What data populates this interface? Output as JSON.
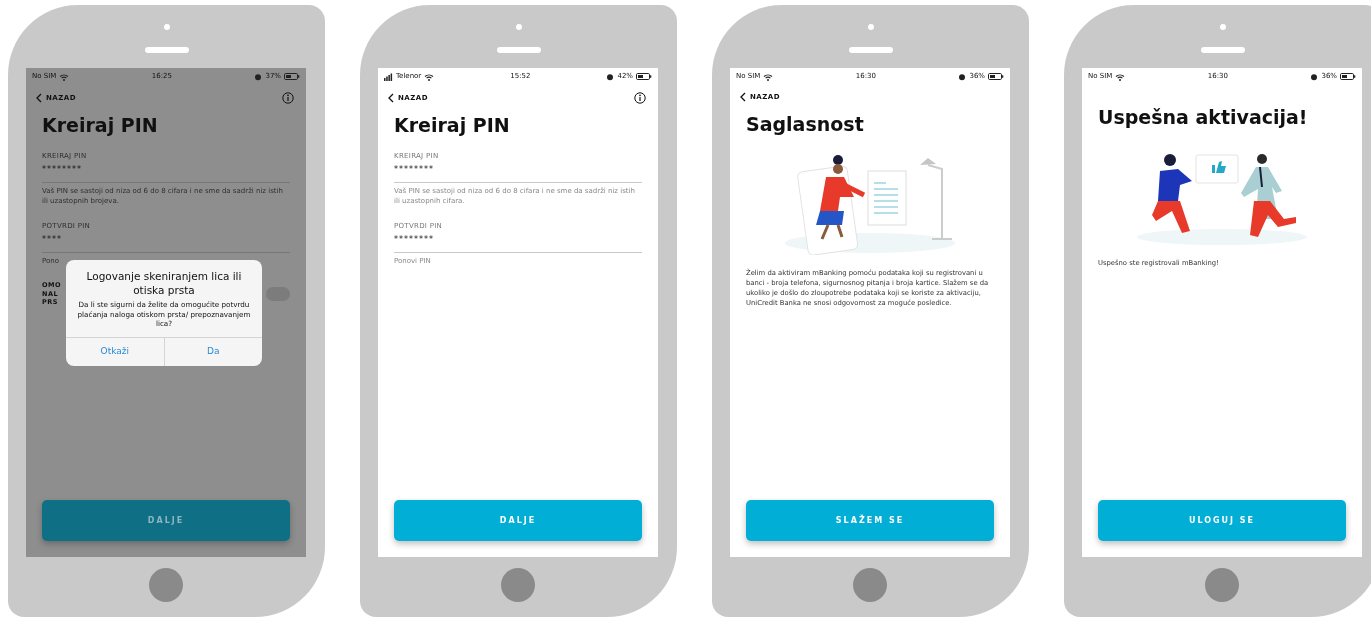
{
  "phones": [
    {
      "kind": "pin",
      "dimmed": true,
      "status": {
        "carrier": "No SIM",
        "signal": false,
        "time": "16:25",
        "battery": "37%"
      },
      "back": "NAZAD",
      "info": true,
      "title": "Kreiraj PIN",
      "fields": [
        {
          "label": "KREIRAJ PIN",
          "value": "********",
          "hint": "Vaš PIN se sastoji od niza od 6 do 8 cifara i ne sme da sadrži niz istih ili uzastopnih brojeva."
        },
        {
          "label": "POTVRDI PIN",
          "value": "****",
          "hint": "Pono"
        }
      ],
      "toggle": {
        "label_lines": [
          "OMO",
          "NAL",
          "PRS"
        ],
        "on": false
      },
      "dialog": {
        "title": "Logovanje skeniranjem lica ili otiska prsta",
        "message": "Da li ste sigurni da želite da omogućite potvrdu plaćanja naloga otiskom prsta/ prepoznavanjem lica?",
        "buttons": [
          "Otkaži",
          "Da"
        ]
      },
      "button": "DALJE"
    },
    {
      "kind": "pin",
      "dimmed": false,
      "status": {
        "carrier": "Telenor",
        "signal": true,
        "time": "15:52",
        "battery": "42%"
      },
      "back": "NAZAD",
      "info": true,
      "title": "Kreiraj PIN",
      "fields": [
        {
          "label": "KREIRAJ PIN",
          "value": "********",
          "hint": "Vaš PIN se sastoji od niza od 6 do 8 cifara i ne sme da sadrži niz istih ili uzastopnih cifara."
        },
        {
          "label": "POTVRDI PIN",
          "value": "********",
          "hint": "Ponovi PIN"
        }
      ],
      "button": "DALJE"
    },
    {
      "kind": "consent",
      "dimmed": false,
      "status": {
        "carrier": "No SIM",
        "signal": false,
        "time": "16:30",
        "battery": "36%"
      },
      "back": "NAZAD",
      "info": false,
      "title": "Saglasnost",
      "text": "Želim da aktiviram mBanking pomoću podataka koji su registrovani u banci - broja telefona, sigurnosnog pitanja i broja kartice. Slažem se da ukoliko je došlo do zloupotrebe podataka koji se koriste za aktivaciju, UniCredit Banka ne snosi odgovornost za moguće posledice.",
      "button": "SLAŽEM SE"
    },
    {
      "kind": "success",
      "dimmed": false,
      "status": {
        "carrier": "No SIM",
        "signal": false,
        "time": "16:30",
        "battery": "36%"
      },
      "info": false,
      "title": "Uspešna aktivacija!",
      "text": "Uspešno ste registrovali mBanking!",
      "button": "ULOGUJ SE"
    }
  ]
}
